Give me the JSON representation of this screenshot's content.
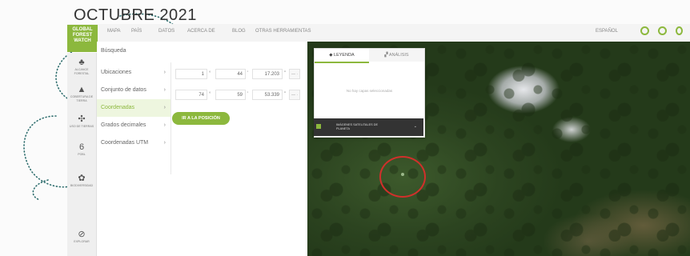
{
  "page": {
    "title": "OCTUBRE 2021"
  },
  "logo": {
    "line1": "GLOBAL",
    "line2": "FOREST",
    "line3": "WATCH"
  },
  "nav": {
    "items": [
      "MAPA",
      "PAÍS",
      "DATOS",
      "ACERCA DE",
      "BLOG",
      "OTRAS HERRAMIENTAS"
    ],
    "language": "ESPAÑOL"
  },
  "sidebar": {
    "items": [
      {
        "icon": "tree-icon",
        "label": "ALCANCE FORESTAL"
      },
      {
        "icon": "fire-icon",
        "label": "COBERTURA DE TIERRA"
      },
      {
        "icon": "people-icon",
        "label": "USO DE TIERRAS"
      },
      {
        "icon": "flag-icon",
        "label": "POBL"
      },
      {
        "icon": "paw-icon",
        "label": "BIODIVERSIDAD"
      },
      {
        "icon": "compass-icon",
        "label": "EXPLORAR"
      }
    ]
  },
  "panel": {
    "header": "Búsqueda",
    "menu": [
      "Ubicaciones",
      "Conjunto de datos",
      "Coordenadas",
      "Grados decimales",
      "Coordenadas UTM"
    ],
    "active_index": 2,
    "coords": {
      "lat": {
        "deg": "1",
        "min": "44",
        "sec": "17.203"
      },
      "lon": {
        "deg": "74",
        "min": "59",
        "sec": "53.339"
      }
    },
    "go_button": "IR A LA POSICIÓN"
  },
  "legend": {
    "tab1": "LEYENDA",
    "tab2": "ANÁLISIS",
    "empty_text": "No hay capas seleccionadas",
    "bar_text": "IMÁGENES SATELITALES DE PLANETA"
  },
  "colors": {
    "accent": "#8cb83d",
    "marker": "#d0302b"
  }
}
